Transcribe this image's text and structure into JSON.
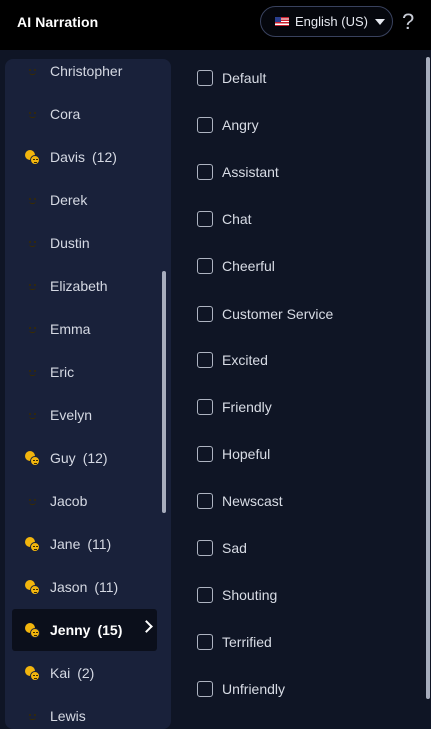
{
  "header": {
    "title": "AI Narration",
    "language": "English (US)",
    "help": "?"
  },
  "voices": [
    {
      "name": "Christopher",
      "count": "",
      "multi": false
    },
    {
      "name": "Cora",
      "count": "",
      "multi": false
    },
    {
      "name": "Davis",
      "count": "(12)",
      "multi": true
    },
    {
      "name": "Derek",
      "count": "",
      "multi": false
    },
    {
      "name": "Dustin",
      "count": "",
      "multi": false
    },
    {
      "name": "Elizabeth",
      "count": "",
      "multi": false
    },
    {
      "name": "Emma",
      "count": "",
      "multi": false
    },
    {
      "name": "Eric",
      "count": "",
      "multi": false
    },
    {
      "name": "Evelyn",
      "count": "",
      "multi": false
    },
    {
      "name": "Guy",
      "count": "(12)",
      "multi": true
    },
    {
      "name": "Jacob",
      "count": "",
      "multi": false
    },
    {
      "name": "Jane",
      "count": "(11)",
      "multi": true
    },
    {
      "name": "Jason",
      "count": "(11)",
      "multi": true
    },
    {
      "name": "Jenny",
      "count": "(15)",
      "multi": true,
      "selected": true
    },
    {
      "name": "Kai",
      "count": "(2)",
      "multi": true
    },
    {
      "name": "Lewis",
      "count": "",
      "multi": false
    }
  ],
  "styles": [
    {
      "label": "Default",
      "checked": false
    },
    {
      "label": "Angry",
      "checked": false
    },
    {
      "label": "Assistant",
      "checked": false
    },
    {
      "label": "Chat",
      "checked": false
    },
    {
      "label": "Cheerful",
      "checked": false
    },
    {
      "label": "Customer Service",
      "checked": false
    },
    {
      "label": "Excited",
      "checked": false
    },
    {
      "label": "Friendly",
      "checked": false
    },
    {
      "label": "Hopeful",
      "checked": false
    },
    {
      "label": "Newscast",
      "checked": false
    },
    {
      "label": "Sad",
      "checked": false
    },
    {
      "label": "Shouting",
      "checked": false
    },
    {
      "label": "Terrified",
      "checked": false
    },
    {
      "label": "Unfriendly",
      "checked": false
    }
  ],
  "icons": {
    "single_voice": "smiley-icon",
    "multi_style_voice": "two-faces-icon",
    "selected_indicator": "chevron-right-icon",
    "language_flag": "us-flag-icon",
    "language_dropdown": "caret-down-icon"
  },
  "colors": {
    "background": "#0f1525",
    "header": "#000000",
    "panel": "#19213a",
    "icon": "#f2b50d"
  }
}
